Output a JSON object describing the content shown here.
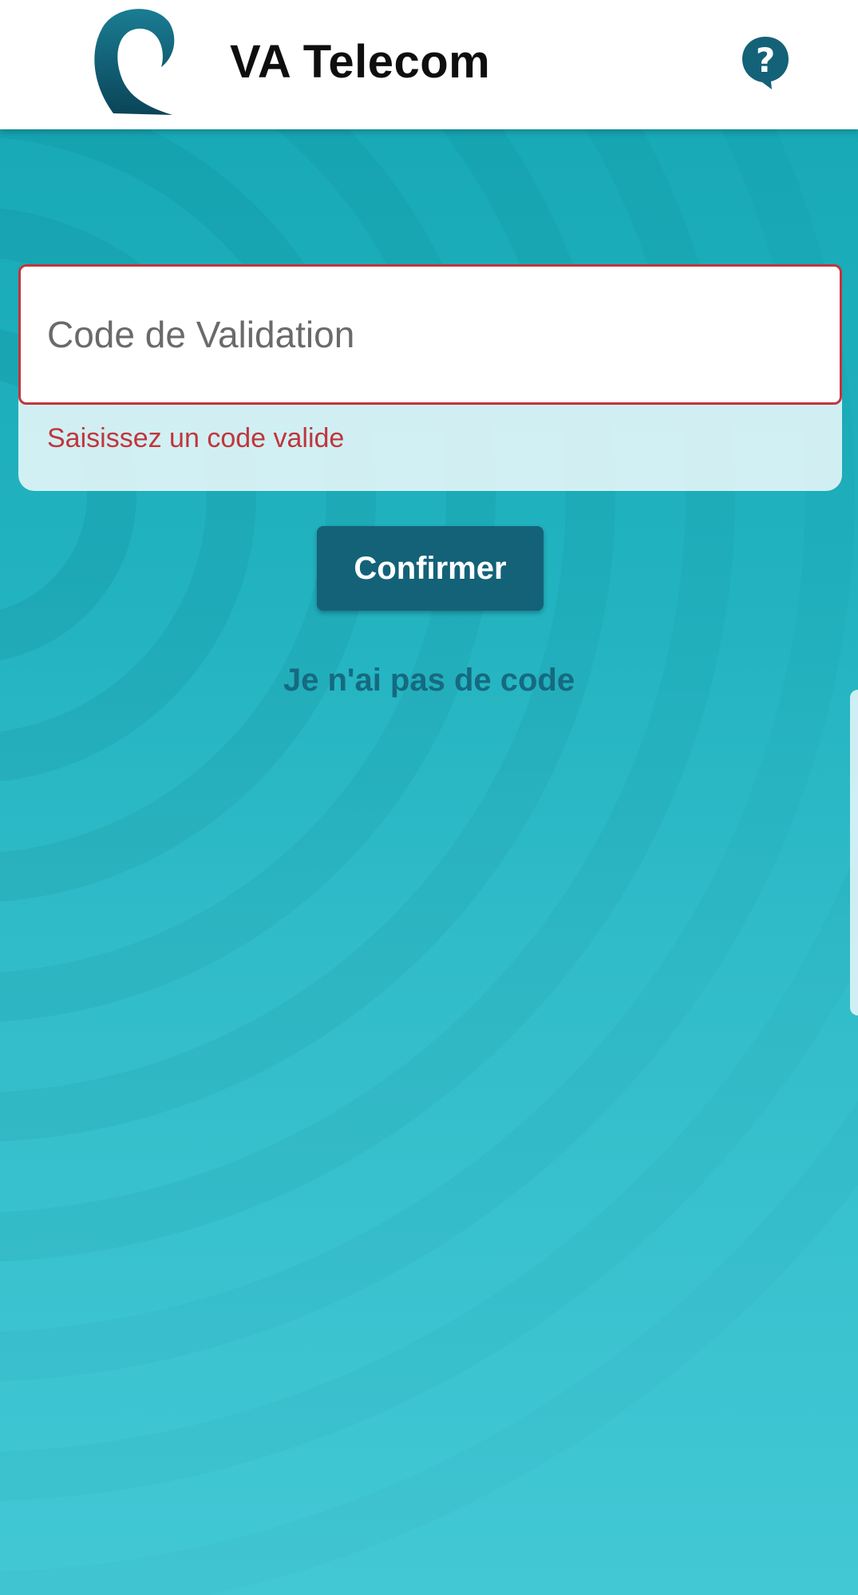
{
  "header": {
    "app_title": "VA Telecom",
    "logo_icon": "va-telecom-logo",
    "help_icon": "help-question-icon"
  },
  "form": {
    "code_input": {
      "value": "",
      "placeholder": "Code de Validation",
      "state": "error"
    },
    "error_message": "Saisissez un code valide",
    "confirm_label": "Confirmer",
    "no_code_link": "Je n'ai pas de code"
  },
  "colors": {
    "primary": "#146278",
    "error": "#c0363c",
    "background_top": "#16a7b4",
    "background_bottom": "#42c8d5",
    "link": "#156a80"
  }
}
